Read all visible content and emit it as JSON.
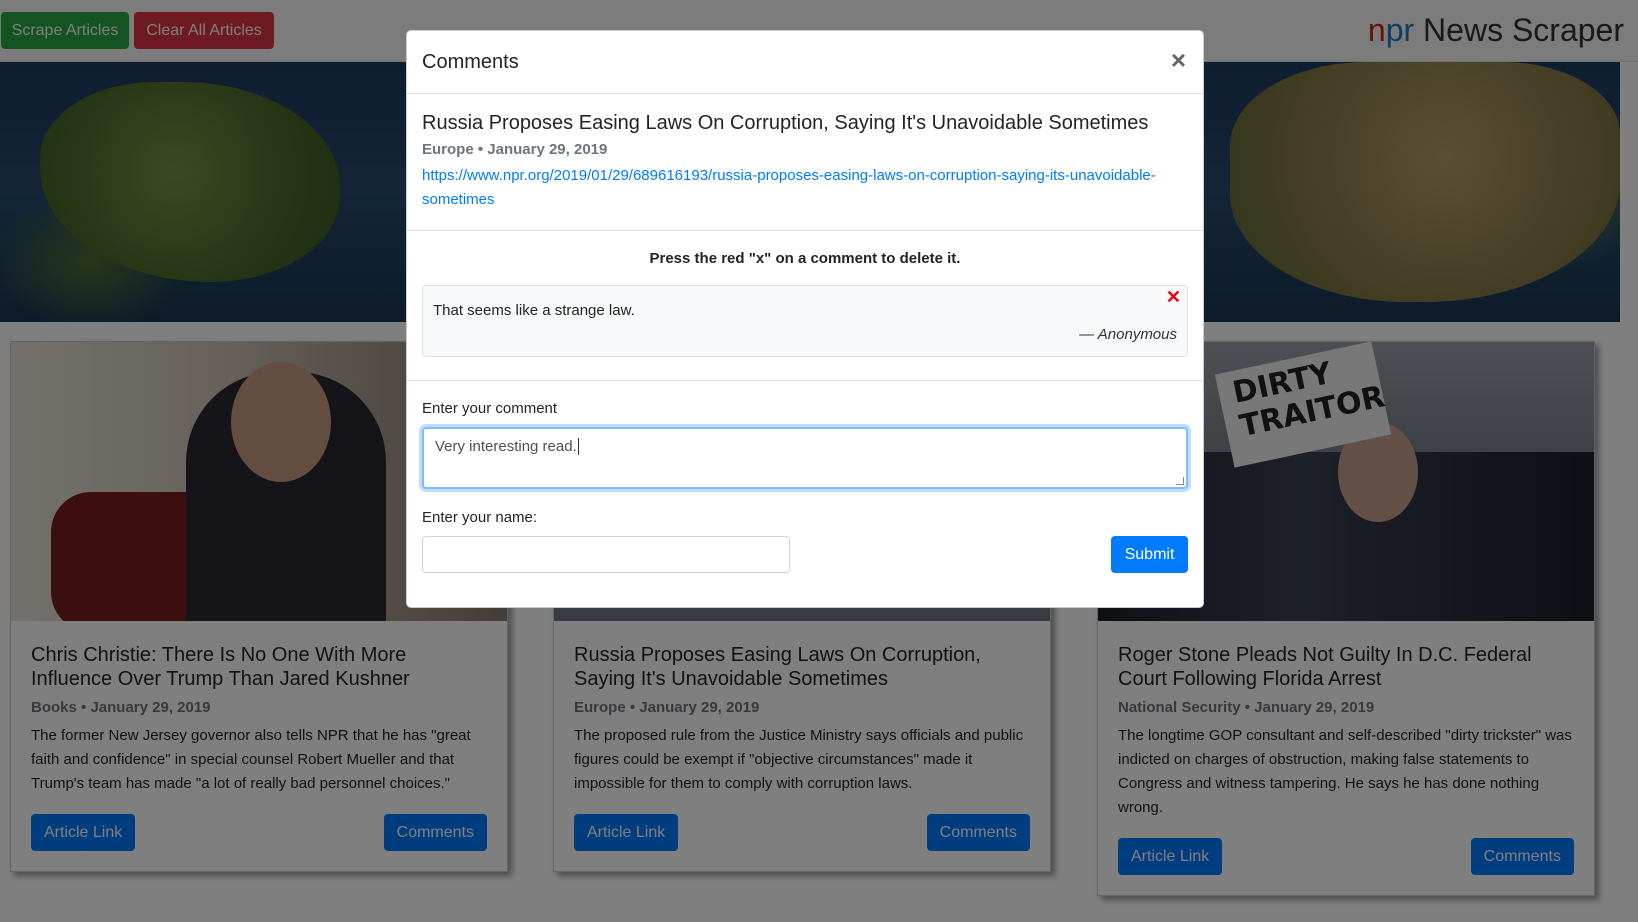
{
  "toolbar": {
    "scrape_label": "Scrape Articles",
    "clear_label": "Clear All Articles"
  },
  "brand": {
    "n": "n",
    "p": "p",
    "r": "r",
    "rest": "News Scraper"
  },
  "cards": [
    {
      "title": "Chris Christie: There Is No One With More Influence Over Trump Than Jared Kushner",
      "category": "Books",
      "date": "January 29, 2019",
      "description": "The former New Jersey governor also tells NPR that he has \"great faith and confidence\" in special counsel Robert Mueller and that Trump's team has made \"a lot of really bad personnel choices.\"",
      "link_label": "Article Link",
      "comments_label": "Comments"
    },
    {
      "title": "Russia Proposes Easing Laws On Corruption, Saying It's Unavoidable Sometimes",
      "category": "Europe",
      "date": "January 29, 2019",
      "description": "The proposed rule from the Justice Ministry says officials and public figures could be exempt if \"objective circumstances\" made it impossible for them to comply with corruption laws.",
      "link_label": "Article Link",
      "comments_label": "Comments"
    },
    {
      "title": "Roger Stone Pleads Not Guilty In D.C. Federal Court Following Florida Arrest",
      "category": "National Security",
      "date": "January 29, 2019",
      "description": "The longtime GOP consultant and self-described \"dirty trickster\" was indicted on charges of obstruction, making false statements to Congress and witness tampering. He says he has done nothing wrong.",
      "link_label": "Article Link",
      "comments_label": "Comments",
      "sign_text_line1": "DIRTY",
      "sign_text_line2": "TRAITOR"
    }
  ],
  "modal": {
    "title": "Comments",
    "close_glyph": "×",
    "article": {
      "title": "Russia Proposes Easing Laws On Corruption, Saying It's Unavoidable Sometimes",
      "meta": "Europe • January 29, 2019",
      "url": "https://www.npr.org/2019/01/29/689616193/russia-proposes-easing-laws-on-corruption-saying-its-unavoidable-sometimes"
    },
    "hint": "Press the red \"x\" on a comment to delete it.",
    "comments": [
      {
        "text": "That seems like a strange law.",
        "author": "Anonymous",
        "dash": "—",
        "delete_glyph": "✕"
      }
    ],
    "form": {
      "comment_label": "Enter your comment",
      "comment_value": "Very interesting read.",
      "name_label": "Enter your name:",
      "name_value": "",
      "submit_label": "Submit"
    }
  },
  "colors": {
    "primary": "#007bff",
    "success": "#28a745",
    "danger": "#dc3545"
  }
}
